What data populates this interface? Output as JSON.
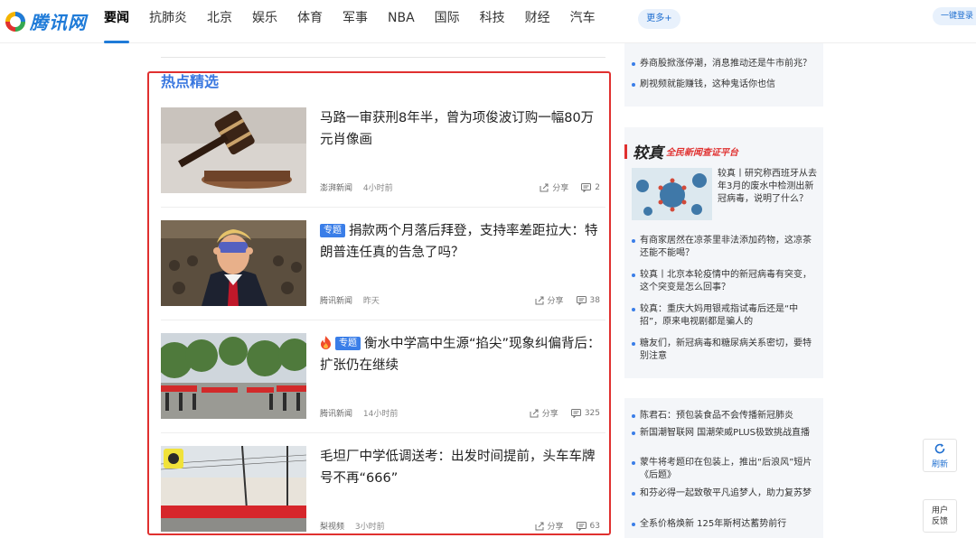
{
  "brand": {
    "logo_text": "腾讯网"
  },
  "nav": {
    "items": [
      "要闻",
      "抗肺炎",
      "北京",
      "娱乐",
      "体育",
      "军事",
      "NBA",
      "国际",
      "科技",
      "财经",
      "汽车"
    ],
    "active": "要闻",
    "more_label": "更多+"
  },
  "header": {
    "login_label": "一键登录"
  },
  "section": {
    "title": "热点精选"
  },
  "articles": [
    {
      "title": "马路一审获刑8年半，曾为项俊波订购一幅80万元肖像画",
      "tag": "",
      "hot": false,
      "source": "澎湃新闻",
      "time": "4小时前",
      "share_label": "分享",
      "comments": "2"
    },
    {
      "title": "捐款两个月落后拜登，支持率差距拉大：特朗普连任真的告急了吗？",
      "tag": "专题",
      "hot": false,
      "source": "腾讯新闻",
      "time": "昨天",
      "share_label": "分享",
      "comments": "38"
    },
    {
      "title": "衡水中学高中生源“掐尖”现象纠偏背后：扩张仍在继续",
      "tag": "专题",
      "hot": true,
      "source": "腾讯新闻",
      "time": "14小时前",
      "share_label": "分享",
      "comments": "325"
    },
    {
      "title": "毛坦厂中学低调送考：出发时间提前，头车车牌号不再“666”",
      "tag": "",
      "hot": false,
      "source": "梨视频",
      "time": "3小时前",
      "share_label": "分享",
      "comments": "63"
    }
  ],
  "sidebar_top": [
    "券商股掀涨停潮，消息推动还是牛市前兆？",
    "刷视频就能赚钱，这种鬼话你也信"
  ],
  "jiaozhen": {
    "title": "较真",
    "subtitle": "全民新闻查证平台",
    "feature": "较真丨研究称西班牙从去年3月的废水中检测出新冠病毒，说明了什么？",
    "items": [
      "有商家居然在凉茶里非法添加药物，这凉茶还能不能喝？",
      "较真丨北京本轮疫情中的新冠病毒有突变，这个突变是怎么回事？",
      "较真：重庆大妈用银戒指试毒后还是“中招”，原来电视剧都是骗人的",
      "糖友们，新冠病毒和糖尿病关系密切，要特别注意"
    ]
  },
  "sidebar_bottom": [
    "陈君石：预包装食品不会传播新冠肺炎",
    "新国潮智联网 国潮荣威PLUS极致挑战直播",
    "蒙牛将考题印在包装上，推出“后浪风”短片《后题》",
    "和芬必得一起致敬平凡追梦人，助力复苏梦",
    "全系价格焕新 125年斯柯达蓄势前行"
  ],
  "float": {
    "refresh_label": "刷新",
    "feedback_line1": "用户",
    "feedback_line2": "反馈"
  },
  "colors": {
    "accent": "#1f7bd8",
    "tag_blue": "#3a7ee8",
    "highlight_red": "#e0302f"
  }
}
